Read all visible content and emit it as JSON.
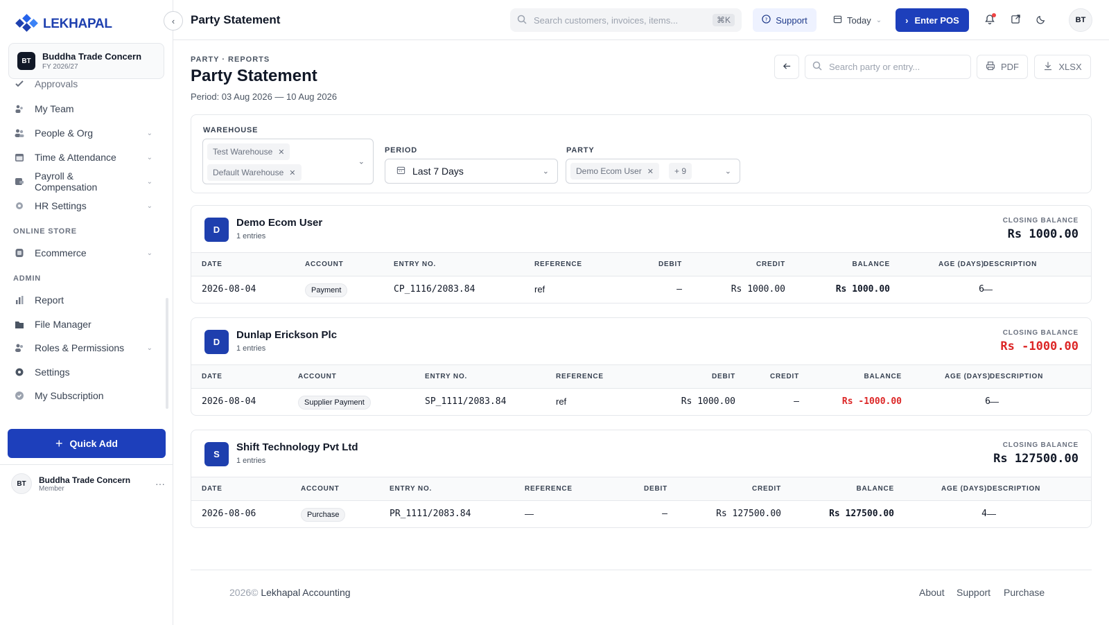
{
  "app": {
    "name": "LEKHAPAL"
  },
  "org": {
    "badge": "BT",
    "name": "Buddha Trade Concern",
    "fy": "FY 2026/27"
  },
  "sidebar": {
    "partial_item": "Approvals",
    "items": [
      {
        "label": "My Team"
      },
      {
        "label": "People & Org"
      },
      {
        "label": "Time & Attendance"
      },
      {
        "label": "Payroll & Compensation"
      },
      {
        "label": "HR Settings"
      }
    ],
    "section_store": "ONLINE STORE",
    "store_items": [
      {
        "label": "Ecommerce"
      }
    ],
    "section_admin": "ADMIN",
    "admin_items": [
      {
        "label": "Report"
      },
      {
        "label": "File Manager"
      },
      {
        "label": "Roles & Permissions"
      },
      {
        "label": "Settings"
      },
      {
        "label": "My Subscription"
      }
    ],
    "quick_add": "Quick Add",
    "user": {
      "initials": "BT",
      "name": "Buddha Trade Concern",
      "role": "Member"
    }
  },
  "topbar": {
    "title": "Party Statement",
    "search_placeholder": "Search customers, invoices, items...",
    "shortcut": "⌘K",
    "support": "Support",
    "today": "Today",
    "enter_pos": "Enter POS",
    "avatar": "BT"
  },
  "page": {
    "breadcrumb": "PARTY · REPORTS",
    "title": "Party Statement",
    "period": "Period: 03 Aug 2026 — 10 Aug 2026",
    "search_placeholder": "Search party or entry...",
    "pdf": "PDF",
    "xlsx": "XLSX"
  },
  "filters": {
    "warehouse_label": "WAREHOUSE",
    "warehouses": [
      "Test Warehouse",
      "Default Warehouse"
    ],
    "period_label": "PERIOD",
    "period_value": "Last 7 Days",
    "party_label": "PARTY",
    "party_value": "Demo Ecom User",
    "party_more": "+ 9"
  },
  "columns": {
    "date": "DATE",
    "account": "ACCOUNT",
    "entry": "ENTRY NO.",
    "reference": "REFERENCE",
    "debit": "DEBIT",
    "credit": "CREDIT",
    "balance": "BALANCE",
    "age": "AGE (DAYS)",
    "description": "DESCRIPTION"
  },
  "closing_label": "CLOSING BALANCE",
  "parties": [
    {
      "initial": "D",
      "name": "Demo Ecom User",
      "count": "1 entries",
      "closing": "Rs 1000.00",
      "negative": false,
      "rows": [
        {
          "date": "2026-08-04",
          "account": "Payment",
          "entry": "CP_1116/2083.84",
          "reference": "ref",
          "debit": "–",
          "credit": "Rs 1000.00",
          "balance": "Rs 1000.00",
          "age": "6",
          "description": "—"
        }
      ]
    },
    {
      "initial": "D",
      "name": "Dunlap Erickson Plc",
      "count": "1 entries",
      "closing": "Rs -1000.00",
      "negative": true,
      "rows": [
        {
          "date": "2026-08-04",
          "account": "Supplier Payment",
          "entry": "SP_1111/2083.84",
          "reference": "ref",
          "debit": "Rs 1000.00",
          "credit": "–",
          "balance": "Rs -1000.00",
          "age": "6",
          "description": "—"
        }
      ]
    },
    {
      "initial": "S",
      "name": "Shift Technology Pvt Ltd",
      "count": "1 entries",
      "closing": "Rs 127500.00",
      "negative": false,
      "rows": [
        {
          "date": "2026-08-06",
          "account": "Purchase",
          "entry": "PR_1111/2083.84",
          "reference": "—",
          "debit": "–",
          "credit": "Rs 127500.00",
          "balance": "Rs 127500.00",
          "age": "4",
          "description": "—"
        }
      ]
    }
  ],
  "footer": {
    "year": "2026©",
    "company": "Lekhapal Accounting",
    "links": [
      "About",
      "Support",
      "Purchase"
    ]
  }
}
